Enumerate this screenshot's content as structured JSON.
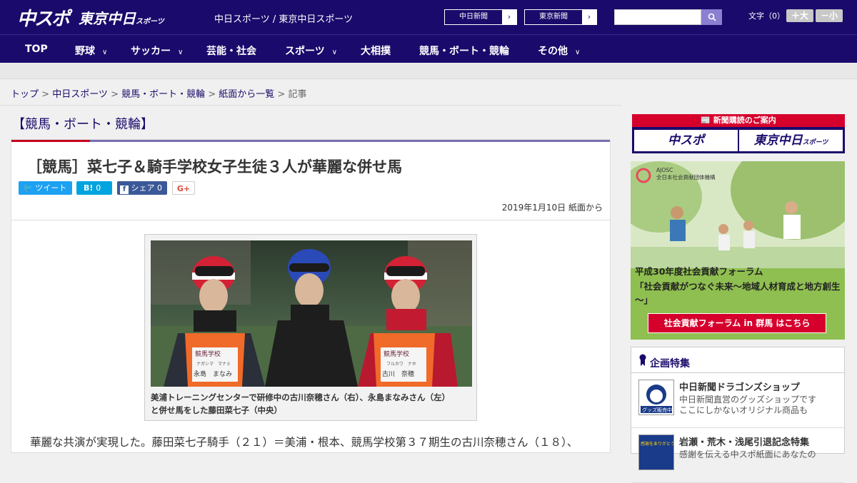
{
  "header": {
    "logo_chunichi": "中スポ",
    "logo_tokyo": "東京中日",
    "logo_tokyo_small": "スポーツ",
    "tagline": "中日スポーツ / 東京中日スポーツ",
    "links": [
      {
        "label": "中日新聞"
      },
      {
        "label": "東京新聞"
      }
    ],
    "search": {
      "value": "",
      "placeholder": ""
    },
    "font_size_label": "文字（0）",
    "font_larger": "＋大",
    "font_smaller": "－小"
  },
  "nav": [
    {
      "label": "TOP",
      "dropdown": false
    },
    {
      "label": "野球",
      "dropdown": true
    },
    {
      "label": "サッカー",
      "dropdown": true
    },
    {
      "label": "芸能・社会",
      "dropdown": false
    },
    {
      "label": "スポーツ",
      "dropdown": true
    },
    {
      "label": "大相撲",
      "dropdown": false
    },
    {
      "label": "競馬・ボート・競輪",
      "dropdown": false
    },
    {
      "label": "その他",
      "dropdown": true
    }
  ],
  "breadcrumb": {
    "items": [
      "トップ",
      "中日スポーツ",
      "競馬・ボート・競輪",
      "紙面から一覧"
    ],
    "current": "記事"
  },
  "section_title": "【競馬・ボート・競輪】",
  "article": {
    "headline": "［競馬］菜七子＆騎手学校女子生徒３人が華麗な併せ馬",
    "share": {
      "tweet": "ツイート",
      "hatena": "B!",
      "hatena_count": "0",
      "facebook": "シェア",
      "facebook_count": "0",
      "gplus": "G+"
    },
    "date": "2019年1月10日 紙面から",
    "caption_line1": "美浦トレーニングセンターで研修中の古川奈穂さん（右）、永島まなみさん（左）",
    "caption_line2": "と併せ馬をした藤田菜七子（中央）",
    "photo_text": {
      "left_bib": "競馬学校",
      "left_furigana": "ナガシマ　マナミ",
      "left_name": "永島　まなみ",
      "right_bib": "競馬学校",
      "right_furigana": "フルカワ　ナホ",
      "right_name": "古川　奈穂"
    },
    "body": "華麗な共演が実現した。藤田菜七子騎手（２１）＝美浦・根本、競馬学校第３７期生の古川奈穂さん（１８）、"
  },
  "sidebar": {
    "subscribe": {
      "header": "新聞購読のご案内",
      "chunichi": "中スポ",
      "tokyo": "東京中日",
      "tokyo_small": "スポーツ"
    },
    "ad": {
      "org1": "AJOSC",
      "org2": "全日本社会貢献団体機構",
      "line1": "平成30年度社会貢献フォーラム",
      "line2": "「社会貢献がつなぐ未来～地域人材育成と地方創生～」",
      "button": "社会貢献フォーラム in 群馬 はこちら"
    },
    "features": {
      "title": "企画特集",
      "items": [
        {
          "title": "中日新聞ドラゴンズショップ",
          "desc1": "中日新聞直営のグッズショップです",
          "desc2": "ここにしかないオリジナル商品も",
          "thumb": "グッズ販売中"
        },
        {
          "title": "岩瀬・荒木・浅尾引退記念特集",
          "desc1": "感謝を伝える中スポ紙面にあなたの",
          "desc2": "",
          "thumb": "感謝をありがとう"
        }
      ]
    }
  },
  "colors": {
    "brand_navy": "#1a0a6b",
    "accent_red": "#c4001e",
    "twitter": "#1da1f2",
    "hatena": "#00a4de",
    "facebook": "#3b5998"
  }
}
